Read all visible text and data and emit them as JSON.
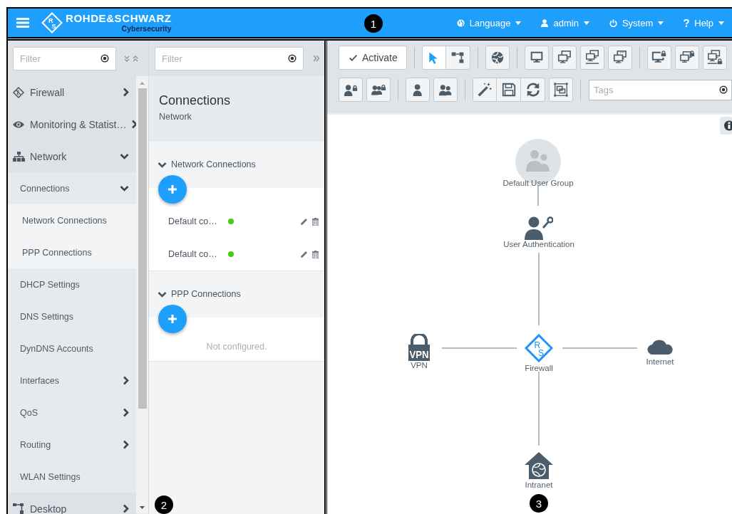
{
  "header": {
    "callout": "1",
    "logo": {
      "mark": [
        "R",
        "S"
      ],
      "name": "ROHDE&SCHWARZ",
      "tagline": "Cybersecurity"
    },
    "menus": [
      {
        "label": "Language"
      },
      {
        "label": "admin"
      },
      {
        "label": "System"
      },
      {
        "label": "Help"
      }
    ]
  },
  "navigation": {
    "filter": {
      "placeholder": "Filter"
    },
    "items": [
      {
        "label": "Firewall",
        "expanded": false
      },
      {
        "label": "Monitoring & Statist…",
        "expanded": false
      },
      {
        "label": "Network",
        "expanded": true,
        "children": [
          {
            "label": "Connections",
            "expanded": true,
            "children": [
              {
                "label": "Network Connections"
              },
              {
                "label": "PPP Connections"
              }
            ]
          },
          {
            "label": "DHCP Settings"
          },
          {
            "label": "DNS Settings"
          },
          {
            "label": "DynDNS Accounts"
          },
          {
            "label": "Interfaces",
            "expanded": false
          },
          {
            "label": "QoS",
            "expanded": false
          },
          {
            "label": "Routing",
            "expanded": false
          },
          {
            "label": "WLAN Settings"
          }
        ]
      },
      {
        "label": "Desktop",
        "expanded": false
      }
    ]
  },
  "connections_panel": {
    "callout": "2",
    "filter": {
      "placeholder": "Filter"
    },
    "title": "Connections",
    "subtitle": "Network",
    "sections": [
      {
        "title": "Network Connections",
        "expanded": true,
        "rows": [
          {
            "name": "Default co…",
            "color": "#44cc11"
          },
          {
            "name": "Default co…",
            "color": "#44cc11"
          }
        ]
      },
      {
        "title": "PPP Connections",
        "expanded": true,
        "empty_text": "Not configured."
      }
    ]
  },
  "toolbar": {
    "activate_label": "Activate",
    "mode_tools": [
      {
        "selected": true
      },
      {
        "selected": false
      }
    ],
    "tags": {
      "placeholder": "Tags"
    }
  },
  "topology": {
    "callout": "3",
    "nodes": [
      {
        "kind": "user_group",
        "label": "Default User Group"
      },
      {
        "kind": "authentication",
        "label": "User Authentication"
      },
      {
        "kind": "vpn",
        "label": "VPN",
        "mark": "VPN"
      },
      {
        "kind": "firewall",
        "label": "Firewall",
        "mark": [
          "R",
          "S"
        ]
      },
      {
        "kind": "internet",
        "label": "Internet"
      },
      {
        "kind": "intranet",
        "label": "Intranet"
      }
    ]
  }
}
